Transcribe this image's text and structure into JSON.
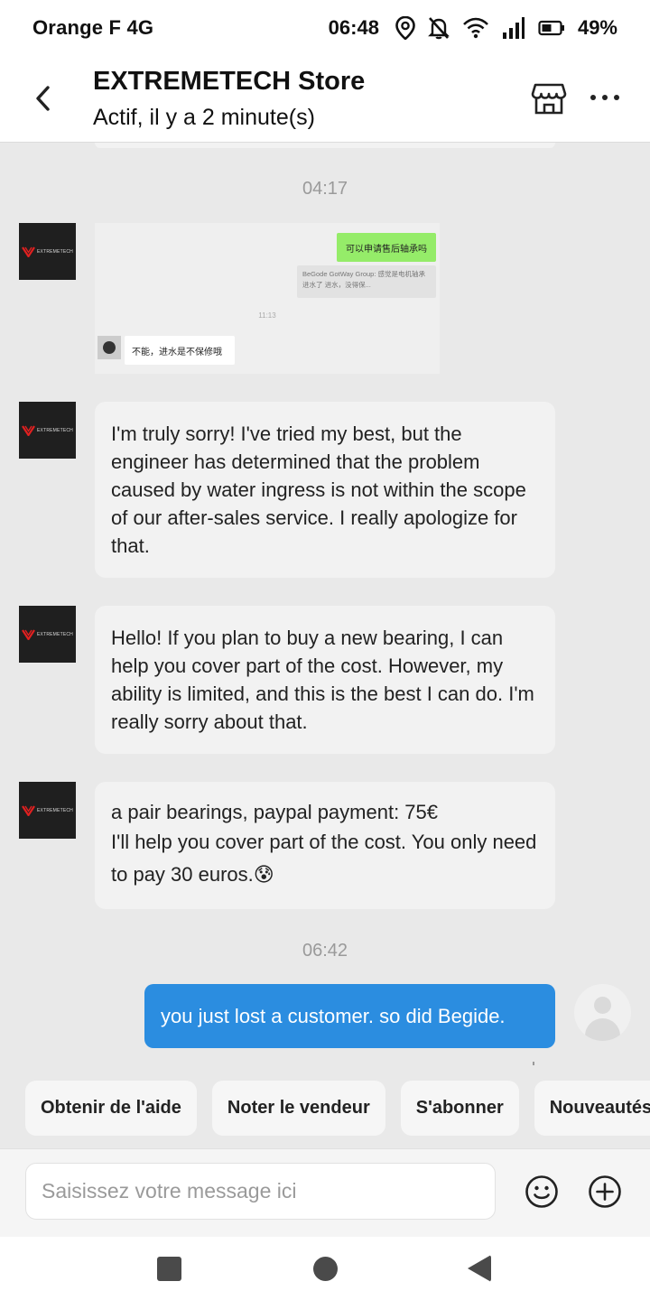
{
  "status_bar": {
    "carrier": "Orange F 4G",
    "time": "06:48",
    "battery": "49%",
    "icons": [
      "location-icon",
      "bell-off-icon",
      "wifi-icon",
      "signal-icon",
      "battery-icon"
    ]
  },
  "header": {
    "title": "EXTREMETECH Store",
    "subtitle": "Actif, il y a 2 minute(s)",
    "icons": [
      "back-arrow-icon",
      "store-icon",
      "more-icon"
    ]
  },
  "timestamps": [
    "04:17",
    "06:42"
  ],
  "seller": {
    "avatar_text": "EXTREMETECH",
    "image_message": {
      "green_bubble": "可以申请售后轴承吗",
      "quote_text": "BeGode GotWay Group: 感觉是电机轴承进水了 进水，没得保...",
      "time": "11:13",
      "reply": "不能，进水是不保修哦"
    },
    "messages": [
      {
        "text": "I'm truly sorry! I've tried my best, but the engineer has determined that the problem caused by water ingress is not within the scope of our after-sales service. I really apologize for that."
      },
      {
        "text": "Hello! If you plan to buy a new bearing, I can help you cover part of the cost. However, my ability is limited, and this is the best I can do. I'm really sorry about that."
      },
      {
        "line1": "a pair bearings, paypal payment: 75€",
        "line2": "I'll help you cover part of the cost. You only need to pay 30 euros.",
        "emoji": "😰"
      }
    ]
  },
  "outgoing": {
    "text": "you just lost a customer. so did Begide."
  },
  "quick_replies": [
    "Obtenir de l'aide",
    "Noter le vendeur",
    "S'abonner",
    "Nouveautés"
  ],
  "composer": {
    "placeholder": "Saisissez votre message ici",
    "icons": [
      "emoji-icon",
      "plus-icon"
    ]
  },
  "colors": {
    "accent_blue": "#2b8de0",
    "background": "#e9e9e9",
    "bubble_grey": "#f2f2f2",
    "wechat_green": "#95ec69"
  }
}
